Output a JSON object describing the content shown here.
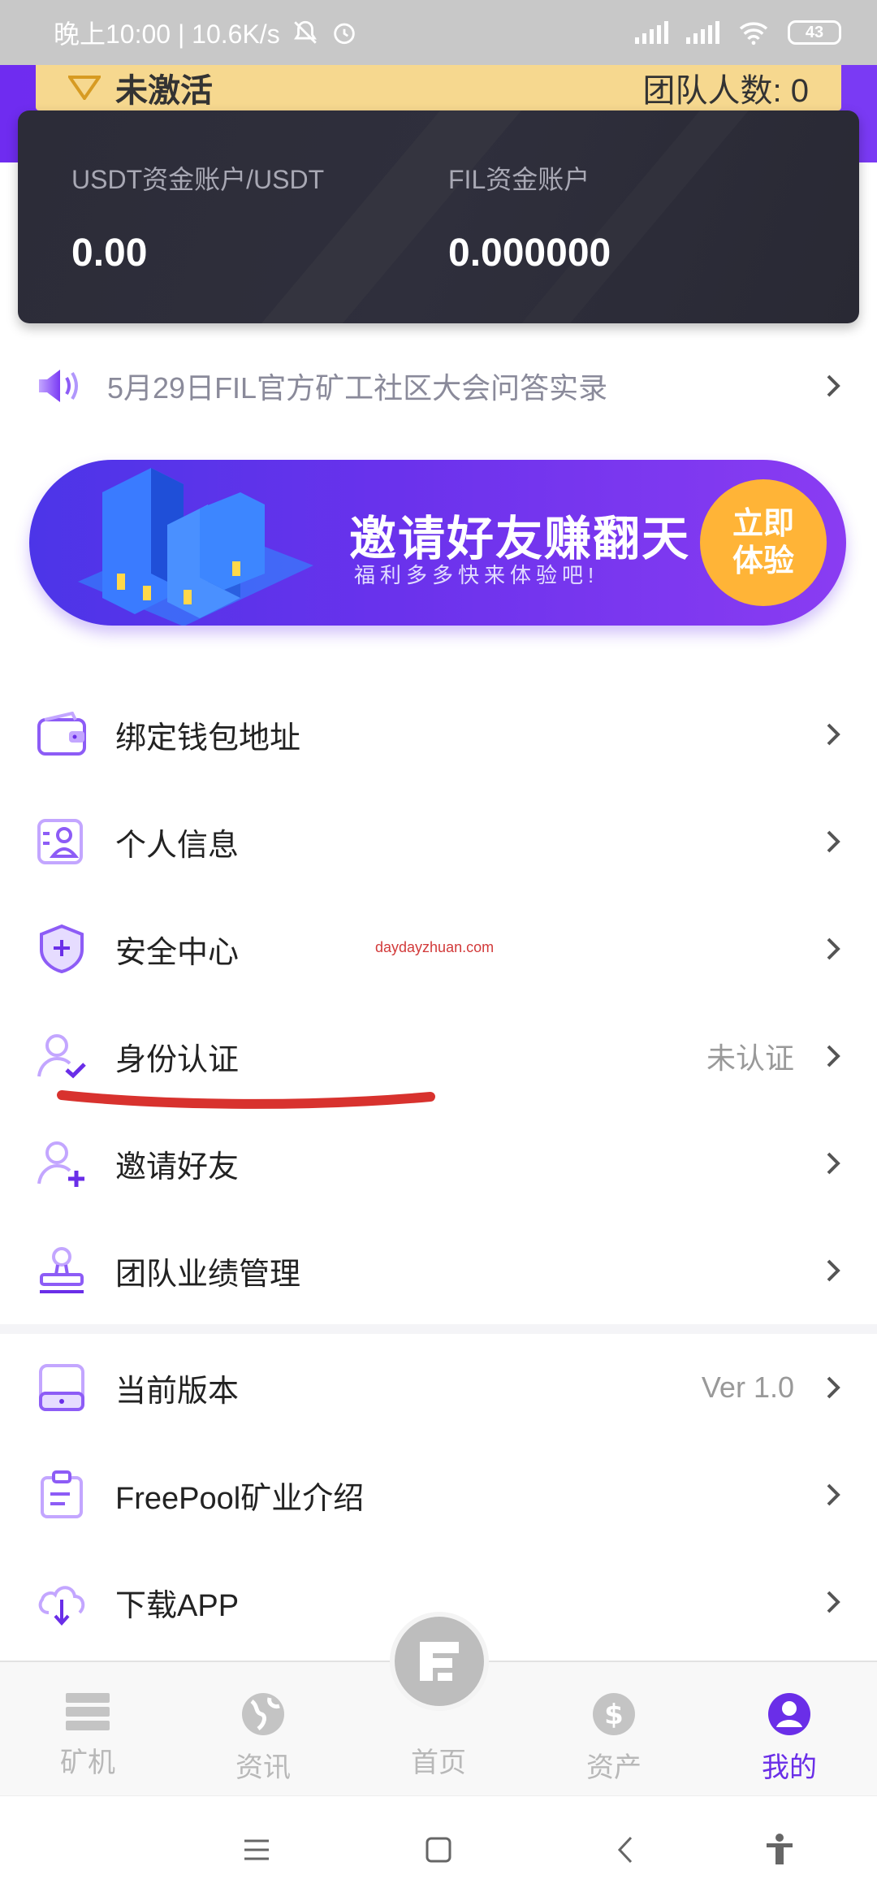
{
  "status_bar": {
    "time_speed": "晚上10:00 | 10.6K/s",
    "battery": "43"
  },
  "level_card": {
    "level": "未激活",
    "team_label": "团队人数: 0"
  },
  "account": {
    "usdt_label": "USDT资金账户/USDT",
    "usdt_value": "0.00",
    "fil_label": "FIL资金账户",
    "fil_value": "0.000000"
  },
  "notice": {
    "text": "5月29日FIL官方矿工社区大会问答实录"
  },
  "banner": {
    "headline": "邀请好友赚翻天",
    "subtitle": "福利多多快来体验吧!",
    "cta_line1": "立即",
    "cta_line2": "体验"
  },
  "menu_primary": [
    {
      "label": "绑定钱包地址",
      "icon": "wallet-icon",
      "status": ""
    },
    {
      "label": "个人信息",
      "icon": "profile-card-icon",
      "status": ""
    },
    {
      "label": "安全中心",
      "icon": "shield-plus-icon",
      "status": ""
    },
    {
      "label": "身份认证",
      "icon": "user-check-icon",
      "status": "未认证"
    },
    {
      "label": "邀请好友",
      "icon": "user-add-icon",
      "status": ""
    },
    {
      "label": "团队业绩管理",
      "icon": "stamp-icon",
      "status": ""
    }
  ],
  "menu_secondary": [
    {
      "label": "当前版本",
      "icon": "tablet-icon",
      "status": "Ver 1.0"
    },
    {
      "label": "FreePool矿业介绍",
      "icon": "clipboard-icon",
      "status": ""
    },
    {
      "label": "下载APP",
      "icon": "cloud-download-icon",
      "status": ""
    }
  ],
  "watermark": "daydayzhuan.com",
  "tabs": [
    {
      "label": "矿机",
      "icon": "server-icon",
      "active": false
    },
    {
      "label": "资讯",
      "icon": "globe-icon",
      "active": false
    },
    {
      "label": "首页",
      "icon": "home-logo-icon",
      "active": false
    },
    {
      "label": "资产",
      "icon": "dollar-icon",
      "active": false
    },
    {
      "label": "我的",
      "icon": "person-icon",
      "active": true
    }
  ],
  "colors": {
    "accent": "#6a2ee8",
    "gold": "#f6d88f",
    "card_dark": "#2c2c38"
  }
}
